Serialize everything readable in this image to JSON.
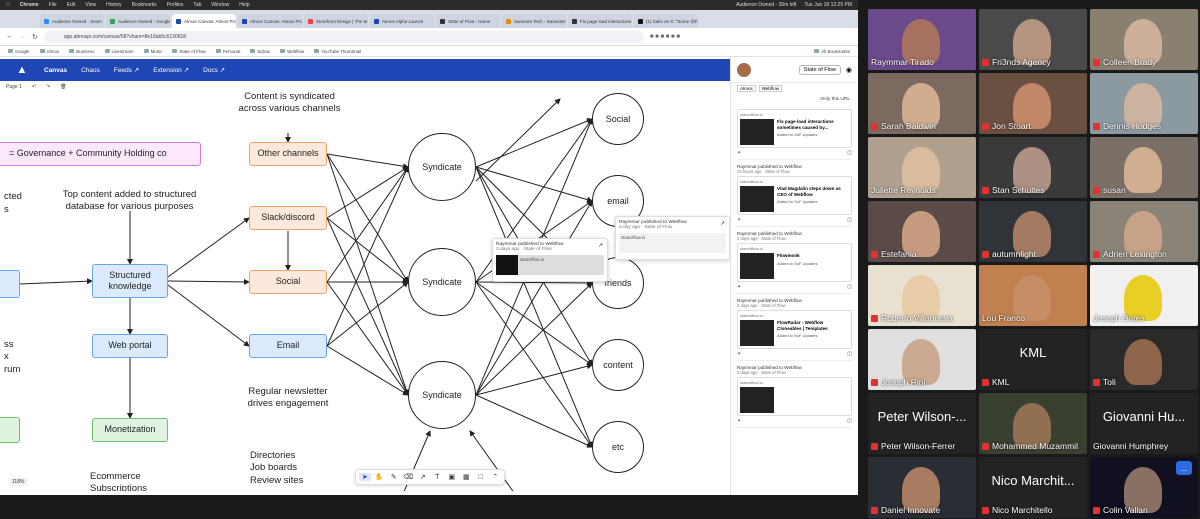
{
  "macbar": {
    "app": "Chrome",
    "menus": [
      "File",
      "Edit",
      "View",
      "History",
      "Bookmarks",
      "Profiles",
      "Tab",
      "Window",
      "Help"
    ],
    "status": "Audience Owned - 35m left",
    "datetime": "Tue Jun 18  12:25 PM"
  },
  "tabs": [
    {
      "label": "Audience Owned · Zoom",
      "color": "#2d8cff",
      "active": false
    },
    {
      "label": "Audience Owned - Google",
      "color": "#34a853",
      "active": false
    },
    {
      "label": "Atmos Canvas: Atmos Prot",
      "color": "#1e46b4",
      "active": true
    },
    {
      "label": "Atmos Canvas: Atmos Proto",
      "color": "#1e46b4",
      "active": false
    },
    {
      "label": "Storefront Design | The bro",
      "color": "#e44",
      "active": false
    },
    {
      "label": "Atmos Alpha Launch",
      "color": "#1e46b4",
      "active": false
    },
    {
      "label": "State of Flow - Home",
      "color": "#333",
      "active": false
    },
    {
      "label": "Sarasota Tech - Sarasota's",
      "color": "#e80",
      "active": false
    },
    {
      "label": "Fix page load interactions",
      "color": "#333",
      "active": false
    },
    {
      "label": "(1) Saks on X: \"Some @Flo",
      "color": "#111",
      "active": false
    }
  ],
  "address": "app.atmospr.com/canvas/58?share=8e18ab5c6130818",
  "bookmarks": [
    "Google",
    "Atmos",
    "Business",
    "Livestream",
    "Music",
    "State of Flow",
    "Personal",
    "Sidrax",
    "Webflow",
    "YouTube Thumbnail"
  ],
  "all_bookmarks": "All Bookmarks",
  "appnav": [
    "Canvas",
    "Chaos",
    "Feeds ↗",
    "Extension ↗",
    "Docs ↗"
  ],
  "page_label": "Page 1",
  "zoom": "118%",
  "diagram": {
    "top_text": "Content is syndicated\nacross various channels",
    "governance": "= Governance + Community Holding co",
    "frag_cted": "cted",
    "frag_s": "s",
    "top_content": "Top content added to structured\ndatabase for various purposes",
    "structured": "Structured\nknowledge",
    "web_portal": "Web portal",
    "monetization": "Monetization",
    "ecommerce": "Ecommerce\nSubscriptions",
    "frag_left": "ss\nx\nrum",
    "other_channels": "Other channels",
    "slack": "Slack/discord",
    "social_node": "Social",
    "email_node": "Email",
    "newsletter": "Regular newsletter\ndrives engagement",
    "directories": "Directories\nJob boards\nReview sites",
    "syndicate": "Syndicate",
    "circles": [
      "Social",
      "email",
      "friends",
      "content",
      "etc"
    ]
  },
  "popups": [
    {
      "who": "Raymmar published to Webflow",
      "when": "3 days ago · State of Flow",
      "domain": "stateofflow.io"
    },
    {
      "who": "Raymmar published to Webflow",
      "when": "a day ago · State of Flow",
      "domain": "stateofflow.io"
    }
  ],
  "sidebar": {
    "title": "State of Flow",
    "tab1": "Atmos",
    "tab2": "Webflow",
    "only_url": "Only this URL",
    "feed": [
      {
        "who": "",
        "when": "",
        "domain": "stateofflow.io",
        "title": "Fix page load interactions sometimes caused by...",
        "sub": "Added to SoF Updates"
      },
      {
        "who": "Raymmar published to Webflow",
        "when": "23 hours ago · State of Flow",
        "domain": "stateofflow.io",
        "title": "Vlad Magdalin steps down as CEO of Webflow",
        "sub": "Added to SoF Updates"
      },
      {
        "who": "Raymmar published to Webflow",
        "when": "2 days ago · State of Flow",
        "domain": "stateofflow.io",
        "title": "Flowmonk",
        "sub": "Added to SoF Updates"
      },
      {
        "who": "Raymmar published to Webflow",
        "when": "2 days ago · State of Flow",
        "domain": "stateofflow.io",
        "title": "FlowRadar - Webflow Cloneables | Templates",
        "sub": "Added to SoF Updates"
      },
      {
        "who": "Raymmar published to Webflow",
        "when": "2 days ago · State of Flow",
        "domain": "stateofflow.io",
        "title": "",
        "sub": ""
      }
    ]
  },
  "participants": [
    {
      "name": "Raymmar Tirado",
      "muted": false,
      "speaking": true,
      "color": "#6a4a8a",
      "skin": "#b07858",
      "label": ""
    },
    {
      "name": "Fri3nds Agency",
      "muted": true,
      "speaking": false,
      "color": "#4a4a4a",
      "skin": "#c8a088",
      "label": ""
    },
    {
      "name": "Colleen Brady",
      "muted": true,
      "speaking": false,
      "color": "#8a8070",
      "skin": "#d8b8a0",
      "label": ""
    },
    {
      "name": "Sarah Baldwin",
      "muted": true,
      "speaking": false,
      "color": "#7a6a60",
      "skin": "#e0b898",
      "label": ""
    },
    {
      "name": "Jon Stuart",
      "muted": true,
      "speaking": false,
      "color": "#6a5040",
      "skin": "#d09070",
      "label": ""
    },
    {
      "name": "Dennis Hodges",
      "muted": true,
      "speaking": false,
      "color": "#8a9aa0",
      "skin": "#d8b8a0",
      "label": ""
    },
    {
      "name": "Juliette Reynolds",
      "muted": false,
      "speaking": false,
      "color": "#b0a090",
      "skin": "#e0c0a0",
      "label": ""
    },
    {
      "name": "Stan Schultes",
      "muted": true,
      "speaking": false,
      "color": "#3a3a3a",
      "skin": "#c0a090",
      "label": ""
    },
    {
      "name": "susan",
      "muted": true,
      "speaking": false,
      "color": "#7a7068",
      "skin": "#e0b898",
      "label": ""
    },
    {
      "name": "Estefania",
      "muted": true,
      "speaking": false,
      "color": "#5a4a48",
      "skin": "#d8a888",
      "label": ""
    },
    {
      "name": "autumnlight",
      "muted": true,
      "speaking": false,
      "color": "#303438",
      "skin": "#b8886a",
      "label": ""
    },
    {
      "name": "Adrien Lexington",
      "muted": true,
      "speaking": false,
      "color": "#8a8478",
      "skin": "#d0a888",
      "label": ""
    },
    {
      "name": "Roberto Villanueva",
      "muted": true,
      "speaking": false,
      "color": "#e8e0d0",
      "skin": "#e8c8a0",
      "label": ""
    },
    {
      "name": "Lou Franco",
      "muted": false,
      "speaking": false,
      "color": "#c08050",
      "skin": "#c89068",
      "label": ""
    },
    {
      "name": "Joseph Bates",
      "muted": false,
      "speaking": false,
      "color": "#f0f0f0",
      "skin": "#e8c800",
      "label": ""
    },
    {
      "name": "Joseph Rini",
      "muted": true,
      "speaking": false,
      "color": "#e0e0e0",
      "skin": "#c8a080",
      "label": ""
    },
    {
      "name": "KML",
      "muted": true,
      "speaking": false,
      "color": "#232323",
      "skin": "",
      "label": "KML"
    },
    {
      "name": "Toli",
      "muted": true,
      "speaking": false,
      "color": "#2a2a2a",
      "skin": "#a07050",
      "label": ""
    },
    {
      "name": "Peter Wilson-Ferrer",
      "muted": true,
      "speaking": false,
      "color": "#232323",
      "skin": "",
      "label": "Peter Wilson-..."
    },
    {
      "name": "Mohammed Muzammil",
      "muted": true,
      "speaking": false,
      "color": "#3a4030",
      "skin": "#a07858",
      "label": ""
    },
    {
      "name": "Giovanni Humphrey",
      "muted": false,
      "speaking": false,
      "color": "#232323",
      "skin": "",
      "label": "Giovanni Hu..."
    },
    {
      "name": "Daniel Innovate",
      "muted": true,
      "speaking": false,
      "color": "#2a2e34",
      "skin": "#c08868",
      "label": ""
    },
    {
      "name": "Nico Marchitello",
      "muted": true,
      "speaking": false,
      "color": "#232323",
      "skin": "",
      "label": "Nico Marchit..."
    },
    {
      "name": "Colin Vallan",
      "muted": true,
      "speaking": false,
      "color": "#101020",
      "skin": "#a08070",
      "label": ""
    }
  ],
  "more_button": "..."
}
